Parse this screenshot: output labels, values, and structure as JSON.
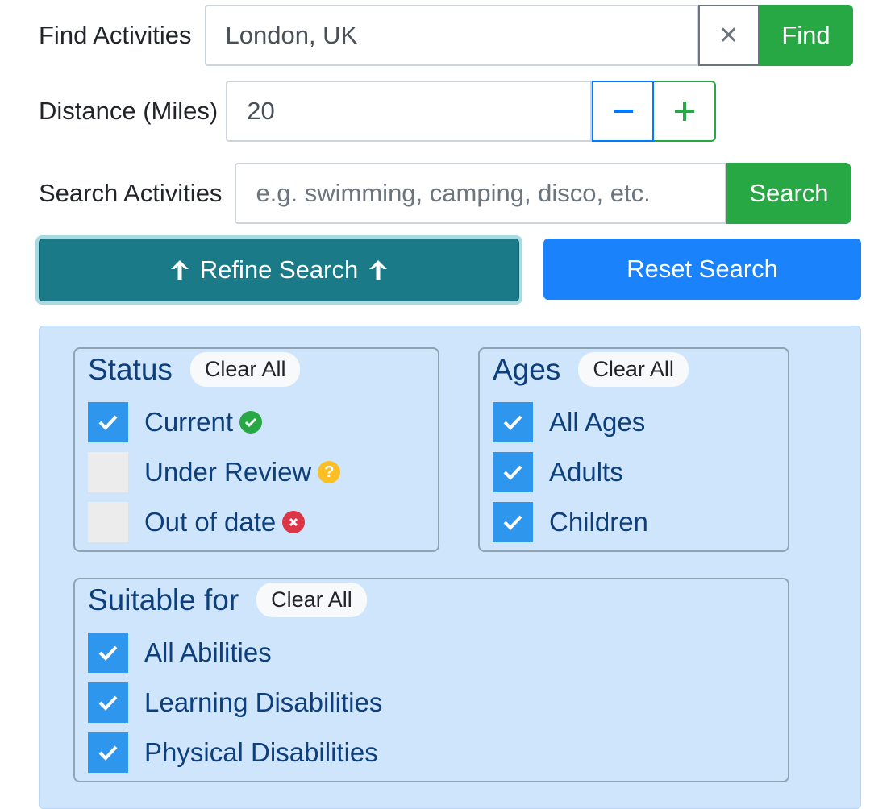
{
  "location": {
    "label": "Find Activities",
    "value": "London, UK",
    "find_label": "Find"
  },
  "distance": {
    "label": "Distance (Miles)",
    "value": "20"
  },
  "search": {
    "label": "Search Activities",
    "placeholder": "e.g. swimming, camping, disco, etc.",
    "button_label": "Search"
  },
  "actions": {
    "refine_label": "Refine Search",
    "reset_label": "Reset Search"
  },
  "filters": {
    "status": {
      "title": "Status",
      "clear_label": "Clear All",
      "options": [
        {
          "label": "Current",
          "checked": true,
          "icon": "check-circle-icon",
          "color": "#28a745"
        },
        {
          "label": "Under Review",
          "checked": false,
          "icon": "question-circle-icon",
          "color": "#fbbf24"
        },
        {
          "label": "Out of date",
          "checked": false,
          "icon": "times-circle-icon",
          "color": "#dc3545"
        }
      ]
    },
    "ages": {
      "title": "Ages",
      "clear_label": "Clear All",
      "options": [
        {
          "label": "All Ages",
          "checked": true
        },
        {
          "label": "Adults",
          "checked": true
        },
        {
          "label": "Children",
          "checked": true
        }
      ]
    },
    "suitable": {
      "title": "Suitable for",
      "clear_label": "Clear All",
      "options": [
        {
          "label": "All Abilities",
          "checked": true
        },
        {
          "label": "Learning Disabilities",
          "checked": true
        },
        {
          "label": "Physical Disabilities",
          "checked": true
        }
      ]
    }
  },
  "colors": {
    "green": "#28a745",
    "blue": "#1a82fb",
    "teal": "#1a7a87",
    "checkbox": "#2e96ec",
    "panel": "#cfe5fb",
    "title_text": "#0d3f7c"
  }
}
